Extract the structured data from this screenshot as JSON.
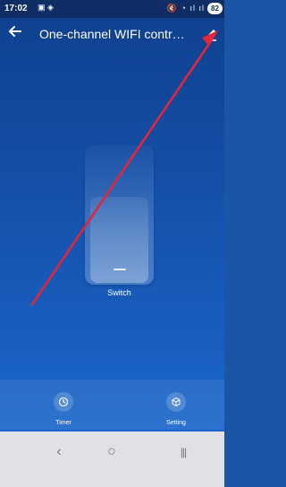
{
  "status_bar": {
    "time": "17:02",
    "left_icons": "▣ ◈",
    "right_icons": "🔇 ◔ ıl ıl",
    "battery": "82"
  },
  "header": {
    "title": "One-channel WIFI controll..."
  },
  "device": {
    "label": "Switch"
  },
  "actions": {
    "timer_label": "Timer",
    "setting_label": "Setting"
  },
  "nav": {
    "back_symbol": "‹",
    "home_symbol": "○",
    "recents_symbol": "|||"
  },
  "colors": {
    "background_top": "#0f3f8d",
    "background_bottom": "#1d6bd0",
    "annotation_arrow": "#e3263a"
  }
}
